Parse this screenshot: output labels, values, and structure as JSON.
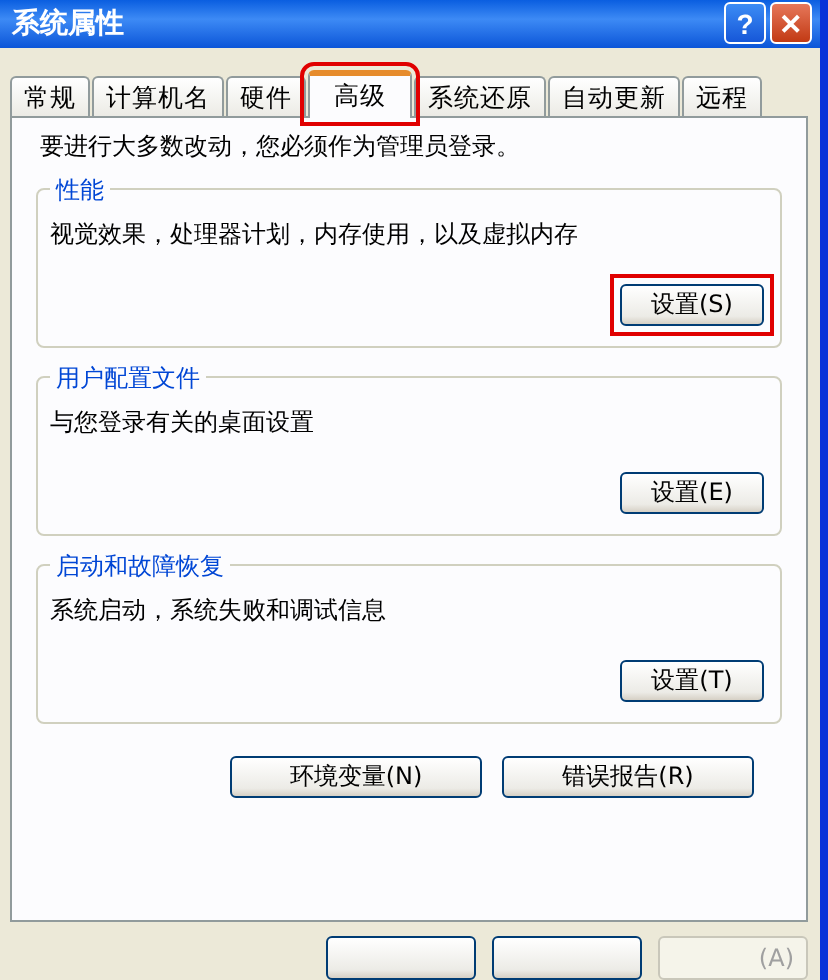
{
  "window": {
    "title": "系统属性"
  },
  "title_buttons": [
    {
      "kind": "help",
      "label": "?"
    },
    {
      "kind": "close",
      "label": "✕"
    }
  ],
  "tabs": [
    {
      "label": "常规",
      "selected": false,
      "highlighted": false
    },
    {
      "label": "计算机名",
      "selected": false,
      "highlighted": false
    },
    {
      "label": "硬件",
      "selected": false,
      "highlighted": false
    },
    {
      "label": "高级",
      "selected": true,
      "highlighted": true
    },
    {
      "label": "系统还原",
      "selected": false,
      "highlighted": false
    },
    {
      "label": "自动更新",
      "selected": false,
      "highlighted": false
    },
    {
      "label": "远程",
      "selected": false,
      "highlighted": false
    }
  ],
  "notice": "要进行大多数改动，您必须作为管理员登录。",
  "groups": [
    {
      "title": "性能",
      "description": "视觉效果，处理器计划，内存使用，以及虚拟内存",
      "button": {
        "label": "设置(S)",
        "highlighted": true
      }
    },
    {
      "title": "用户配置文件",
      "description": "与您登录有关的桌面设置",
      "button": {
        "label": "设置(E)",
        "highlighted": false
      }
    },
    {
      "title": "启动和故障恢复",
      "description": "系统启动，系统失败和调试信息",
      "button": {
        "label": "设置(T)",
        "highlighted": false
      }
    }
  ],
  "panel_buttons": [
    "环境变量(N)",
    "错误报告(R)"
  ],
  "bottom_buttons": [
    {
      "disabled": false
    },
    {
      "disabled": false
    },
    {
      "label": "(A)",
      "disabled": true
    }
  ]
}
